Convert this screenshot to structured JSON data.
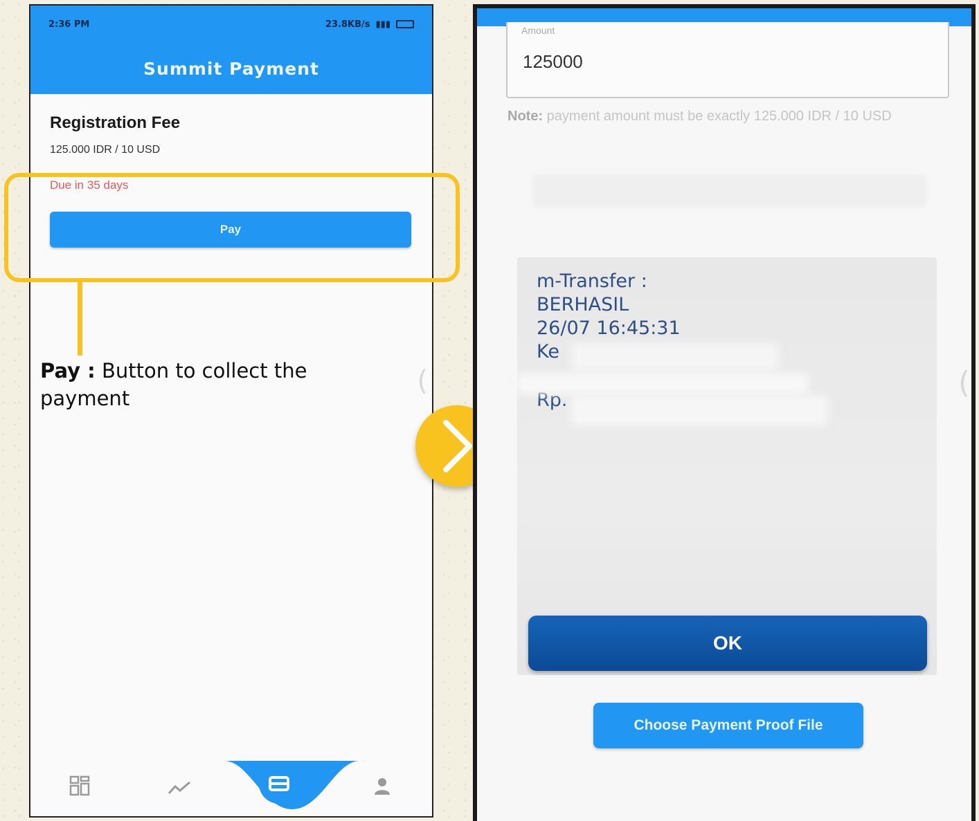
{
  "left_screen": {
    "status_bar": {
      "time": "2:36 PM",
      "network_speed": "23.8KB/s"
    },
    "app_bar": {
      "title": "Summit Payment"
    },
    "fee": {
      "title": "Registration Fee",
      "amount": "125.000 IDR / 10 USD",
      "due": "Due in 35 days"
    },
    "pay_button_label": "Pay",
    "bottom_nav": {
      "items": [
        "dashboard-icon",
        "chart-icon",
        "card-icon",
        "person-icon"
      ]
    }
  },
  "annotation": {
    "label_bold": "Pay :",
    "label_text": " Button to collect the payment"
  },
  "right_screen": {
    "amount_field": {
      "label": "Amount",
      "value": "125000"
    },
    "note": {
      "prefix": "Note:",
      "text": " payment amount must be exactly 125.000 IDR / 10 USD"
    },
    "proof_image": {
      "lines": [
        "m-Transfer :",
        "BERHASIL",
        "26/07 16:45:31",
        "Ke",
        "Rp."
      ],
      "ok_label": "OK"
    },
    "choose_button_label": "Choose Payment Proof File"
  },
  "colors": {
    "primary": "#2196f3",
    "highlight": "#f9c31f",
    "due_text": "#e85a5a",
    "ok_button": "#0b4a95"
  }
}
